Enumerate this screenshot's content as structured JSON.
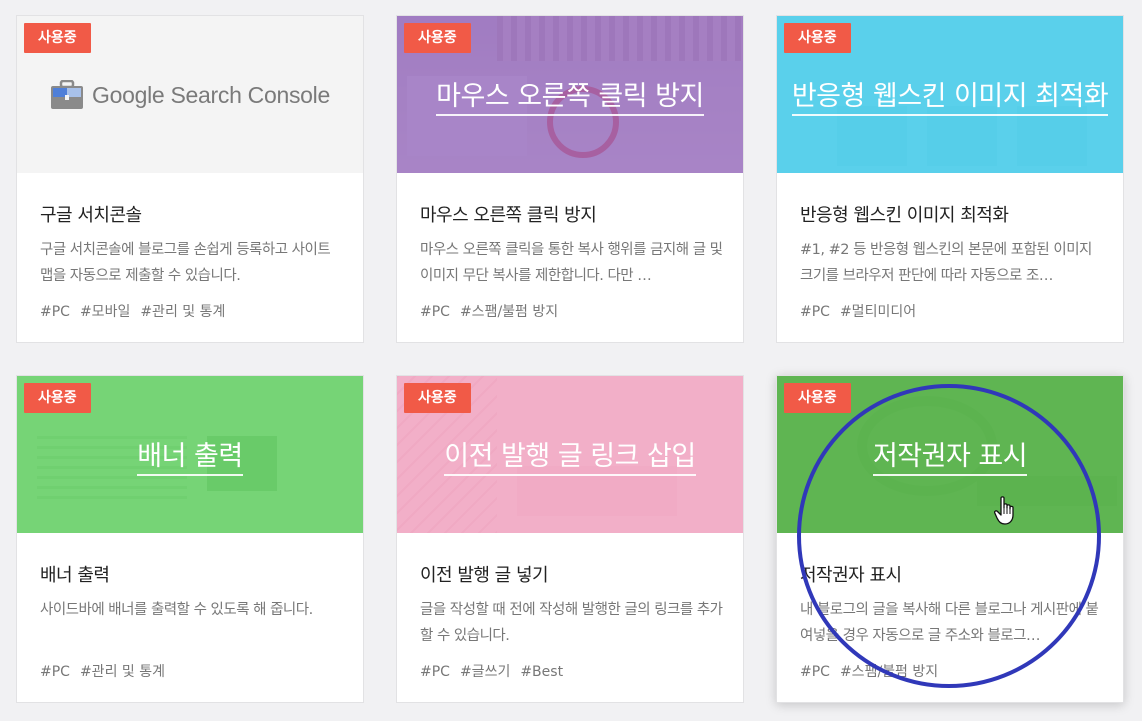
{
  "colors": {
    "badge": "#f15a47",
    "purple_overlay": "#9b6fc0",
    "cyan_overlay": "#4ccbe9",
    "green_overlay": "#6fd36f",
    "pink_overlay": "#f3a6c2",
    "dark_green_overlay": "#5cb54c",
    "annotation_circle": "#3038b9"
  },
  "cards": [
    {
      "badge": "사용중",
      "thumb_title": "",
      "logo_text": "Google Search Console",
      "title": "구글 서치콘솔",
      "desc": "구글 서치콘솔에 블로그를 손쉽게 등록하고 사이트맵을 자동으로 제출할 수 있습니다.",
      "tags": [
        "#PC",
        "#모바일",
        "#관리 및 통계"
      ]
    },
    {
      "badge": "사용중",
      "thumb_title": "마우스 오른쪽 클릭 방지",
      "title": "마우스 오른쪽 클릭 방지",
      "desc": "마우스 오른쪽 클릭을 통한 복사 행위를 금지해 글 및 이미지 무단 복사를 제한합니다. 다만 …",
      "tags": [
        "#PC",
        "#스팸/불펌 방지"
      ]
    },
    {
      "badge": "사용중",
      "thumb_title": "반응형 웹스킨 이미지 최적화",
      "title": "반응형 웹스킨 이미지 최적화",
      "desc": "#1, #2 등 반응형 웹스킨의 본문에 포함된 이미지 크기를 브라우저 판단에 따라 자동으로 조…",
      "tags": [
        "#PC",
        "#멀티미디어"
      ]
    },
    {
      "badge": "사용중",
      "thumb_title": "배너 출력",
      "title": "배너 출력",
      "desc": "사이드바에 배너를 출력할 수 있도록 해 줍니다.",
      "tags": [
        "#PC",
        "#관리 및 통계"
      ]
    },
    {
      "badge": "사용중",
      "thumb_title": "이전 발행 글 링크 삽입",
      "title": "이전 발행 글 넣기",
      "desc": "글을 작성할 때 전에 작성해 발행한 글의 링크를 추가할 수 있습니다.",
      "tags": [
        "#PC",
        "#글쓰기",
        "#Best"
      ]
    },
    {
      "badge": "사용중",
      "thumb_title": "저작권자 표시",
      "title": "저작권자 표시",
      "desc": "내 블로그의 글을 복사해 다른 블로그나 게시판에 붙여넣을 경우 자동으로 글 주소와 블로그…",
      "tags": [
        "#PC",
        "#스팸/불펌 방지"
      ]
    }
  ]
}
